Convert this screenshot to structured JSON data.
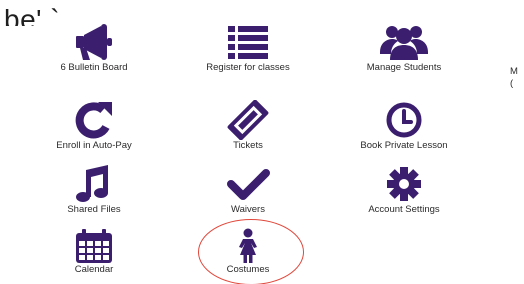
{
  "header": {
    "cut_text": "be'  `"
  },
  "tiles": [
    {
      "label": "6 Bulletin Board",
      "icon": "megaphone-icon"
    },
    {
      "label": "Register for classes",
      "icon": "list-icon"
    },
    {
      "label": "Manage Students",
      "icon": "users-icon"
    },
    {
      "label": "Enroll in Auto-Pay",
      "icon": "refresh-icon"
    },
    {
      "label": "Tickets",
      "icon": "ticket-icon"
    },
    {
      "label": "Book Private Lesson",
      "icon": "clock-icon"
    },
    {
      "label": "Shared Files",
      "icon": "music-note-icon"
    },
    {
      "label": "Waivers",
      "icon": "checkmark-icon"
    },
    {
      "label": "Account Settings",
      "icon": "gear-icon"
    },
    {
      "label": "Calendar",
      "icon": "calendar-icon"
    },
    {
      "label": "Costumes",
      "icon": "dress-figure-icon"
    }
  ],
  "edge_label": "M\n(",
  "colors": {
    "icon": "#3b1f6e",
    "highlight": "#e0483c"
  }
}
